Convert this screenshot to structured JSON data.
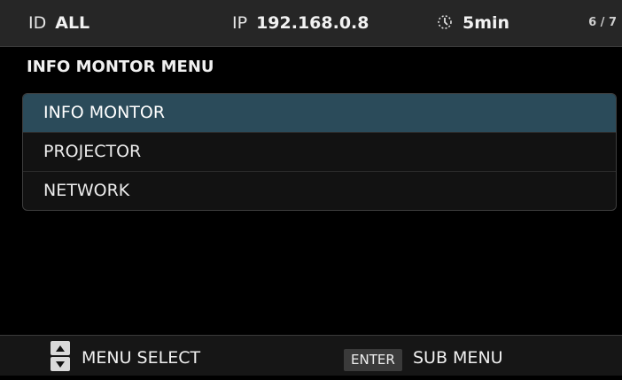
{
  "header": {
    "id_key": "ID",
    "id_value": "ALL",
    "ip_key": "IP",
    "ip_value": "192.168.0.8",
    "timer_icon": "timer-icon",
    "timer_value": "5min",
    "page": "6 / 7"
  },
  "menu": {
    "title": "INFO MONTOR MENU",
    "items": [
      {
        "label": "INFO MONTOR",
        "selected": true
      },
      {
        "label": "PROJECTOR",
        "selected": false
      },
      {
        "label": "NETWORK",
        "selected": false
      }
    ],
    "selected_color": "#2b4b5a"
  },
  "footer": {
    "arrows_icon": "up-down-arrow-icon",
    "select_label": "MENU SELECT",
    "enter_key": "ENTER",
    "sub_label": "SUB MENU"
  }
}
